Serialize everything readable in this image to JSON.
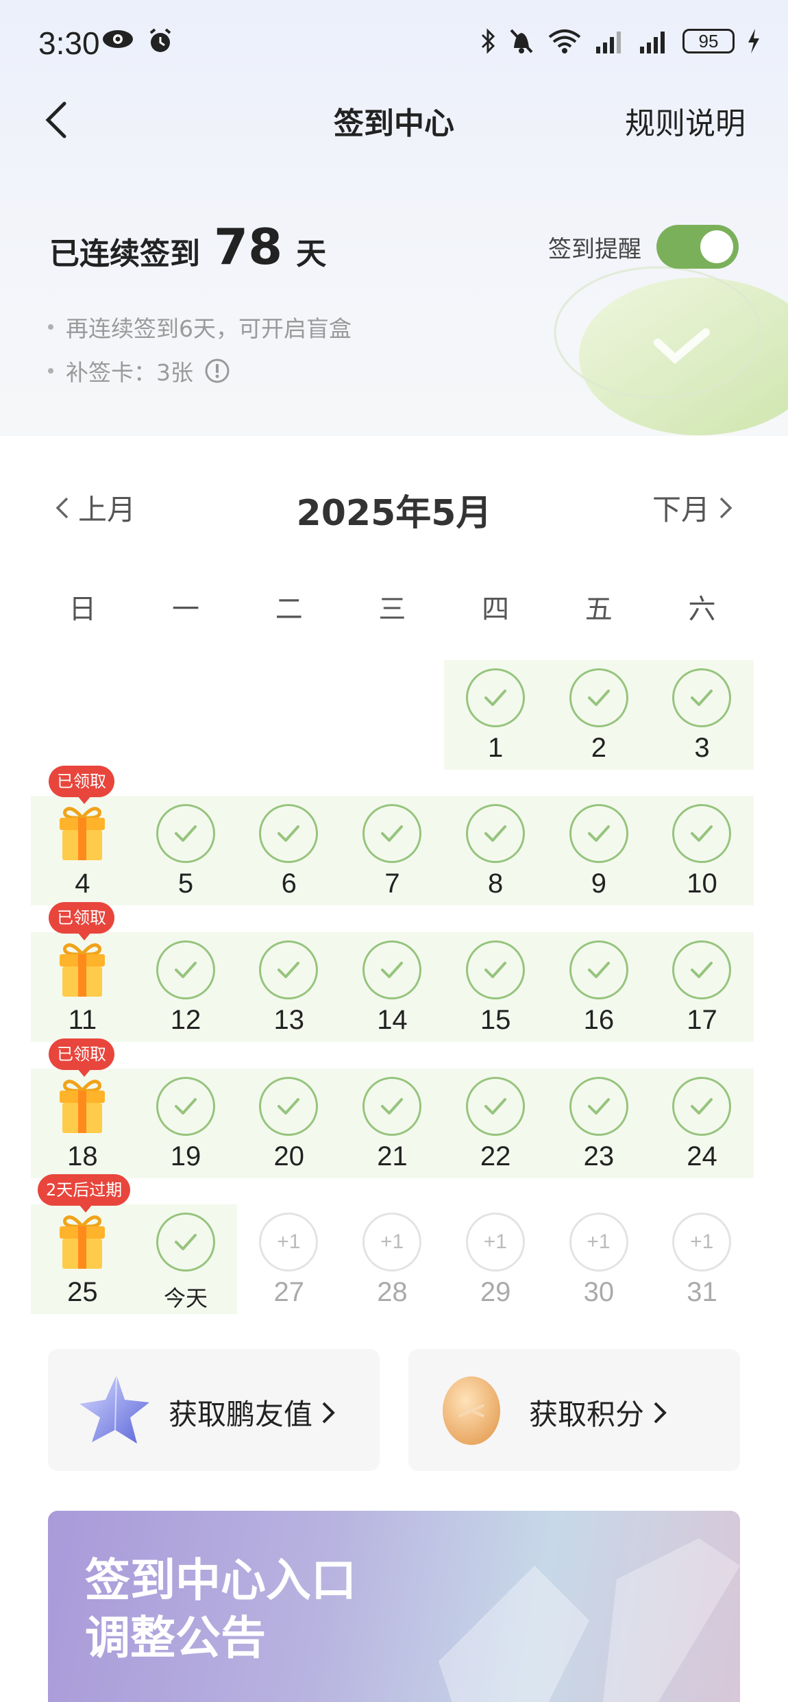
{
  "status_bar": {
    "time": "3:30",
    "battery": "95"
  },
  "header": {
    "title": "签到中心",
    "rules": "规则说明"
  },
  "streak": {
    "prefix": "已连续签到",
    "days": "78",
    "suffix": "天"
  },
  "reminder": {
    "label": "签到提醒",
    "enabled": true
  },
  "tips": [
    "再连续签到6天，可开启盲盒",
    "补签卡：3张"
  ],
  "calendar": {
    "prev_month": "上月",
    "month_title": "2025年5月",
    "next_month": "下月",
    "weekdays": [
      "日",
      "一",
      "二",
      "三",
      "四",
      "五",
      "六"
    ],
    "weeks": [
      [
        null,
        null,
        null,
        null,
        {
          "label": "1",
          "state": "checked"
        },
        {
          "label": "2",
          "state": "checked"
        },
        {
          "label": "3",
          "state": "checked"
        }
      ],
      [
        {
          "label": "4",
          "state": "gift",
          "badge": "已领取"
        },
        {
          "label": "5",
          "state": "checked"
        },
        {
          "label": "6",
          "state": "checked"
        },
        {
          "label": "7",
          "state": "checked"
        },
        {
          "label": "8",
          "state": "checked"
        },
        {
          "label": "9",
          "state": "checked"
        },
        {
          "label": "10",
          "state": "checked"
        }
      ],
      [
        {
          "label": "11",
          "state": "gift",
          "badge": "已领取"
        },
        {
          "label": "12",
          "state": "checked"
        },
        {
          "label": "13",
          "state": "checked"
        },
        {
          "label": "14",
          "state": "checked"
        },
        {
          "label": "15",
          "state": "checked"
        },
        {
          "label": "16",
          "state": "checked"
        },
        {
          "label": "17",
          "state": "checked"
        }
      ],
      [
        {
          "label": "18",
          "state": "gift",
          "badge": "已领取"
        },
        {
          "label": "19",
          "state": "checked"
        },
        {
          "label": "20",
          "state": "checked"
        },
        {
          "label": "21",
          "state": "checked"
        },
        {
          "label": "22",
          "state": "checked"
        },
        {
          "label": "23",
          "state": "checked"
        },
        {
          "label": "24",
          "state": "checked"
        }
      ],
      [
        {
          "label": "25",
          "state": "gift",
          "badge": "2天后过期"
        },
        {
          "label": "今天",
          "state": "checked"
        },
        {
          "label": "27",
          "state": "future",
          "reward": "+1"
        },
        {
          "label": "28",
          "state": "future",
          "reward": "+1"
        },
        {
          "label": "29",
          "state": "future",
          "reward": "+1"
        },
        {
          "label": "30",
          "state": "future",
          "reward": "+1"
        },
        {
          "label": "31",
          "state": "future",
          "reward": "+1"
        }
      ]
    ]
  },
  "cards": [
    {
      "label": "获取鹏友值",
      "icon": "star-icon"
    },
    {
      "label": "获取积分",
      "icon": "coin-icon"
    }
  ],
  "banner": {
    "line1": "签到中心入口",
    "line2": "调整公告"
  },
  "colors": {
    "accent": "#7bb05a",
    "check": "#96c47d",
    "row_bg": "#f4f9ee",
    "badge": "#e8453c"
  }
}
